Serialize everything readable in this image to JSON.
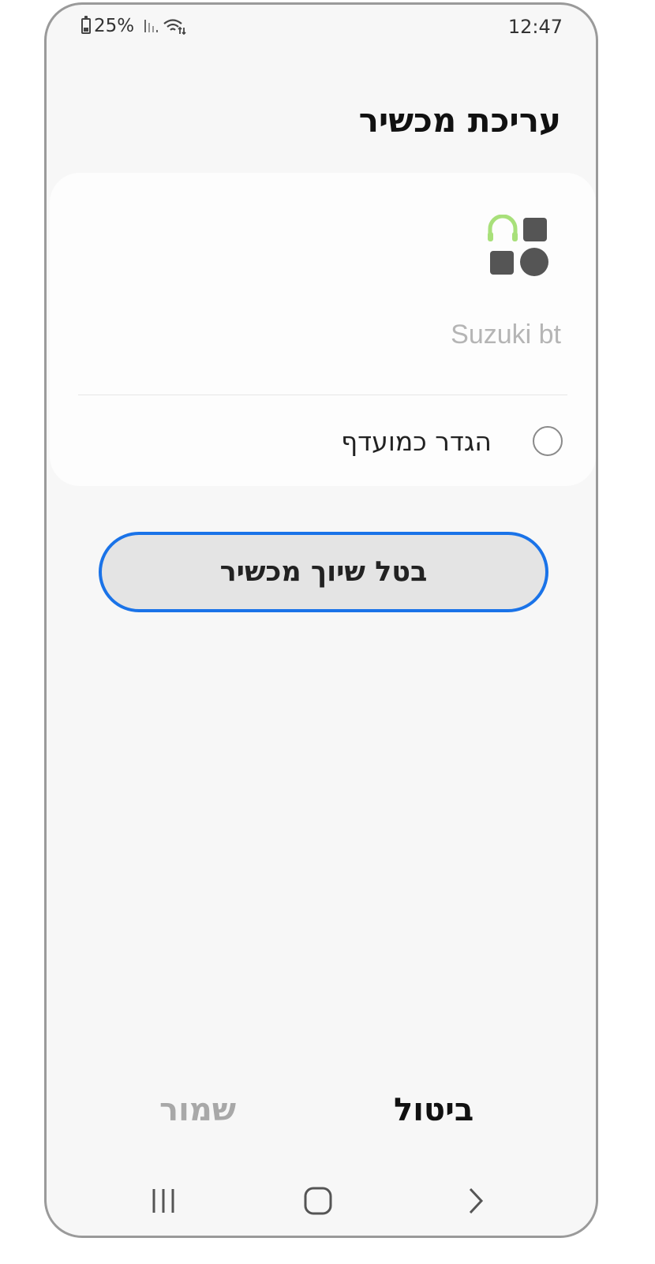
{
  "status_bar": {
    "battery": "25%",
    "time": "12:47",
    "battery_icon": "battery-icon",
    "signal_icon": "cellular-signal-icon",
    "wifi_icon": "wifi-icon"
  },
  "page": {
    "title": "עריכת מכשיר"
  },
  "device_card": {
    "icon": "device-category-icon",
    "icon_accent_color": "#a8e07a",
    "name_value": "Suzuki bt",
    "preferred_label": "הגדר כמועדף",
    "preferred_checked": false
  },
  "unpair_button": {
    "label": "בטל שיוך מכשיר",
    "border_color": "#1a73e8"
  },
  "actions": {
    "cancel_label": "ביטול",
    "save_label": "שמור"
  },
  "nav_bar": {
    "recents_icon": "recents-icon",
    "home_icon": "home-icon",
    "back_icon": "back-icon"
  }
}
